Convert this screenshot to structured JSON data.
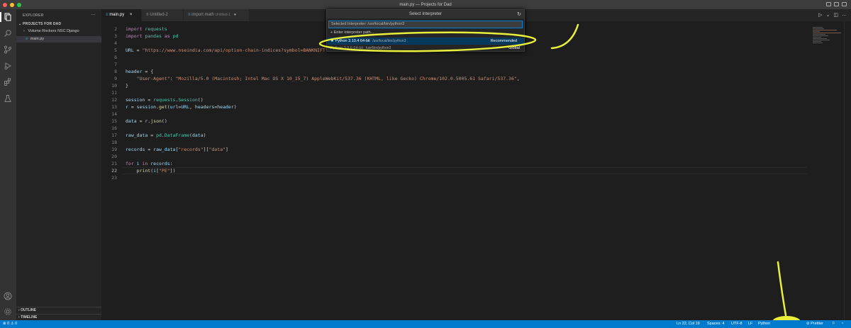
{
  "window": {
    "title": "main.py — Projects for Dad"
  },
  "sidebar": {
    "title": "EXPLORER",
    "more": "…",
    "project": "PROJECTS FOR DAD",
    "items": [
      {
        "label": "Volume Rockers NSC Django",
        "chevron": "›"
      },
      {
        "label": "main.py"
      }
    ],
    "outline": "OUTLINE",
    "timeline": "TIMELINE"
  },
  "tabs": [
    {
      "label": "main.py",
      "close": "×"
    },
    {
      "label": "Untitled-2"
    },
    {
      "label": "import math",
      "hint": "Untitled-1"
    }
  ],
  "quickpick": {
    "title": "Select Interpreter",
    "input_value": "Selected Interpreter: /usr/local/bin/python3",
    "enter_path": "+ Enter interpreter path...",
    "selected_item": {
      "label": "★ Python 3.10.4 64-bit",
      "path": "/usr/local/bin/python3",
      "badge": "Recommended"
    },
    "other_item": {
      "label": "Python 3.9.6 64-bit",
      "path": "/usr/bin/python3",
      "badge": "Global"
    }
  },
  "editor": {
    "lines": [
      {
        "n": "2",
        "html": "<span class='kw'>import</span> <span class='cls'>requests</span>"
      },
      {
        "n": "3",
        "html": "<span class='kw'>import</span> <span class='cls'>pandas</span> <span class='kw'>as</span> <span class='cls'>pd</span>"
      },
      {
        "n": "4",
        "html": ""
      },
      {
        "n": "5",
        "html": "<span class='var'>URL</span> = <span class='str'>\"https://www.nseindia.com/api/option-chain-indices?symbol=BANKNIFTY\"</span>"
      },
      {
        "n": "6",
        "html": ""
      },
      {
        "n": "7",
        "html": ""
      },
      {
        "n": "8",
        "html": "<span class='var'>header</span> = {"
      },
      {
        "n": "9",
        "html": "    <span class='str'>\"User-Agent\"</span>: <span class='str'>\"Mozilla/5.0 (Macintosh; Intel Mac OS X 10_15_7) AppleWebKit/537.36 (KHTML, like Gecko) Chrome/102.0.5005.61 Safari/537.36\"</span>,"
      },
      {
        "n": "10",
        "html": "}"
      },
      {
        "n": "11",
        "html": ""
      },
      {
        "n": "12",
        "html": "<span class='var'>session</span> = <span class='cls'>requests</span>.<span class='cls'>Session</span>()"
      },
      {
        "n": "13",
        "html": "<span class='var'>r</span> = <span class='var'>session</span>.<span class='fn'>get</span>(<span class='var'>url</span>=<span class='var'>URL</span>, <span class='var'>headers</span>=<span class='var'>header</span>)"
      },
      {
        "n": "14",
        "html": ""
      },
      {
        "n": "15",
        "html": "<span class='var'>data</span> = <span class='var'>r</span>.<span class='fn'>json</span>()"
      },
      {
        "n": "16",
        "html": ""
      },
      {
        "n": "17",
        "html": "<span class='var'>raw_data</span> = <span class='cls'>pd</span>.<span class='cls'>DataFrame</span>(<span class='var'>data</span>)"
      },
      {
        "n": "18",
        "html": ""
      },
      {
        "n": "19",
        "html": "<span class='var'>records</span> = <span class='var'>raw_data</span>[<span class='str'>\"records\"</span>][<span class='str'>\"data\"</span>]"
      },
      {
        "n": "20",
        "html": ""
      },
      {
        "n": "21",
        "html": "<span class='kw'>for</span> <span class='var'>i</span> <span class='kw'>in</span> <span class='var'>records</span>:"
      },
      {
        "n": "22",
        "html": "    <span class='fn'>print</span>(<span class='var'>i</span>[<span class='str'>\"PE\"</span>])"
      },
      {
        "n": "23",
        "html": ""
      }
    ]
  },
  "statusbar": {
    "errors": "⊗ 0 ⚠ 0",
    "position": "Ln 22, Col 19",
    "spaces": "Spaces: 4",
    "encoding": "UTF-8",
    "eol": "LF",
    "language": "Python",
    "prettier": "⊘ Prettier"
  },
  "annotation_color": "#e8f03c"
}
